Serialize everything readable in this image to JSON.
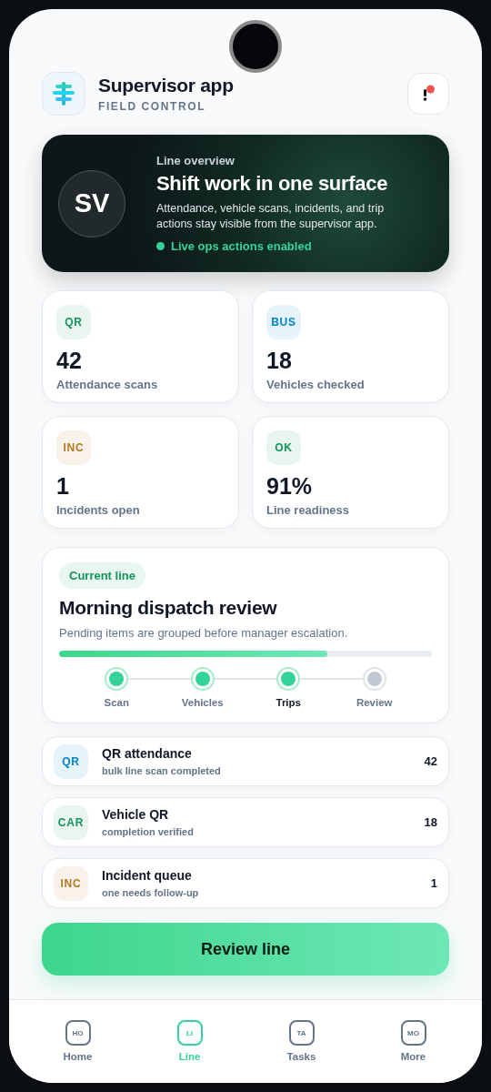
{
  "header": {
    "title": "Supervisor app",
    "subtitle": "FIELD CONTROL",
    "notification_unread": true
  },
  "hero": {
    "avatar": "SV",
    "eyebrow": "Line overview",
    "title": "Shift work in one surface",
    "body": "Attendance, vehicle scans, incidents, and trip actions stay visible from the supervisor app.",
    "status": "Live ops actions enabled",
    "live": true
  },
  "stats": [
    {
      "tag": "QR",
      "color": "#15935a",
      "value": "42",
      "label": "Attendance scans"
    },
    {
      "tag": "BUS",
      "color": "#0284c7",
      "value": "18",
      "label": "Vehicles checked"
    },
    {
      "tag": "INC",
      "color": "#b7791f",
      "value": "1",
      "label": "Incidents open"
    },
    {
      "tag": "OK",
      "color": "#15935a",
      "value": "91%",
      "label": "Line readiness"
    }
  ],
  "current_line": {
    "badge": "Current line",
    "title": "Morning dispatch review",
    "description": "Pending items are grouped before manager escalation.",
    "level": 0.72,
    "steps": [
      {
        "label": "Scan",
        "done": true,
        "selected": false
      },
      {
        "label": "Vehicles",
        "done": true,
        "selected": false
      },
      {
        "label": "Trips",
        "done": true,
        "selected": true
      },
      {
        "label": "Review",
        "done": false,
        "selected": false
      }
    ]
  },
  "queue": [
    {
      "tag": "QR",
      "color": "#0284c7",
      "title": "QR attendance",
      "subtitle": "bulk line scan completed",
      "count": "42"
    },
    {
      "tag": "CAR",
      "color": "#15935a",
      "title": "Vehicle QR",
      "subtitle": "completion verified",
      "count": "18"
    },
    {
      "tag": "INC",
      "color": "#b7791f",
      "title": "Incident queue",
      "subtitle": "one needs follow-up",
      "count": "1"
    }
  ],
  "action_button": "Review line",
  "nav": [
    {
      "icon": "HO",
      "label": "Home",
      "selected": false
    },
    {
      "icon": "LI",
      "label": "Line",
      "selected": true
    },
    {
      "icon": "TA",
      "label": "Tasks",
      "selected": false
    },
    {
      "icon": "MO",
      "label": "More",
      "selected": false
    }
  ]
}
